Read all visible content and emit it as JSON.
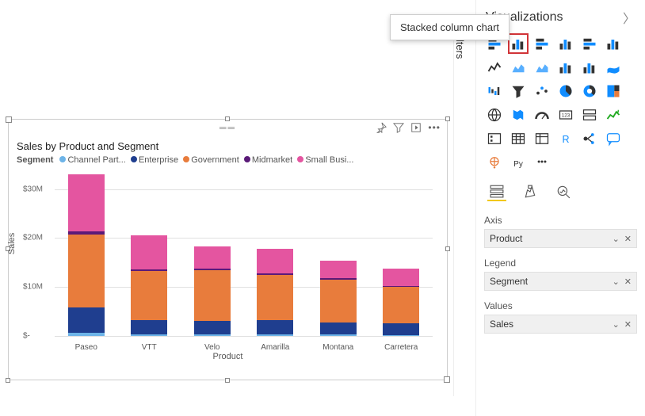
{
  "tooltip": "Stacked column chart",
  "panel": {
    "title": "Visualizations",
    "tabs": {
      "axis": "Axis",
      "legend": "Legend",
      "values": "Values"
    },
    "wells": {
      "axis": "Product",
      "legend": "Segment",
      "values": "Sales"
    }
  },
  "filters": {
    "label": "Filters"
  },
  "visual": {
    "title": "Sales by Product and Segment",
    "legend_label": "Segment",
    "xlabel": "Product",
    "ylabel": "Sales",
    "legend": [
      {
        "name": "Channel Part...",
        "color": "#6db4e8"
      },
      {
        "name": "Enterprise",
        "color": "#1f3e8f"
      },
      {
        "name": "Government",
        "color": "#e87c3c"
      },
      {
        "name": "Midmarket",
        "color": "#5a1a78"
      },
      {
        "name": "Small Busi...",
        "color": "#e455a0"
      }
    ]
  },
  "yticks": [
    {
      "label": "$30M",
      "v": 30
    },
    {
      "label": "$20M",
      "v": 20
    },
    {
      "label": "$10M",
      "v": 10
    },
    {
      "label": "$-",
      "v": 0
    }
  ],
  "chart_data": {
    "type": "bar",
    "stacked": true,
    "title": "Sales by Product and Segment",
    "xlabel": "Product",
    "ylabel": "Sales",
    "ylim": [
      0,
      34
    ],
    "unit": "$M",
    "categories": [
      "Paseo",
      "VTT",
      "Velo",
      "Amarilla",
      "Montana",
      "Carretera"
    ],
    "series": [
      {
        "name": "Channel Partners",
        "color": "#6db4e8",
        "values": [
          0.6,
          0.3,
          0.3,
          0.3,
          0.3,
          0.2
        ]
      },
      {
        "name": "Enterprise",
        "color": "#1f3e8f",
        "values": [
          5.2,
          3.0,
          2.8,
          3.0,
          2.5,
          2.4
        ]
      },
      {
        "name": "Government",
        "color": "#e87c3c",
        "values": [
          15.0,
          10.0,
          10.4,
          9.2,
          8.7,
          7.4
        ]
      },
      {
        "name": "Midmarket",
        "color": "#5a1a78",
        "values": [
          0.6,
          0.3,
          0.3,
          0.3,
          0.3,
          0.2
        ]
      },
      {
        "name": "Small Business",
        "color": "#e455a0",
        "values": [
          11.6,
          7.0,
          4.5,
          5.0,
          3.6,
          3.6
        ]
      }
    ]
  },
  "viz_icons": [
    "stacked-bar-h",
    "stacked-column",
    "clustered-bar",
    "clustered-column",
    "100-bar",
    "100-column",
    "line",
    "area",
    "stacked-area",
    "line-column",
    "line-column2",
    "ribbon",
    "waterfall",
    "funnel",
    "scatter",
    "pie",
    "donut",
    "treemap",
    "map",
    "filled-map",
    "gauge",
    "card",
    "multi-card",
    "kpi",
    "slicer",
    "table",
    "matrix",
    "r-visual",
    "decomp",
    "qna",
    "arcgis",
    "py-visual",
    "more"
  ]
}
